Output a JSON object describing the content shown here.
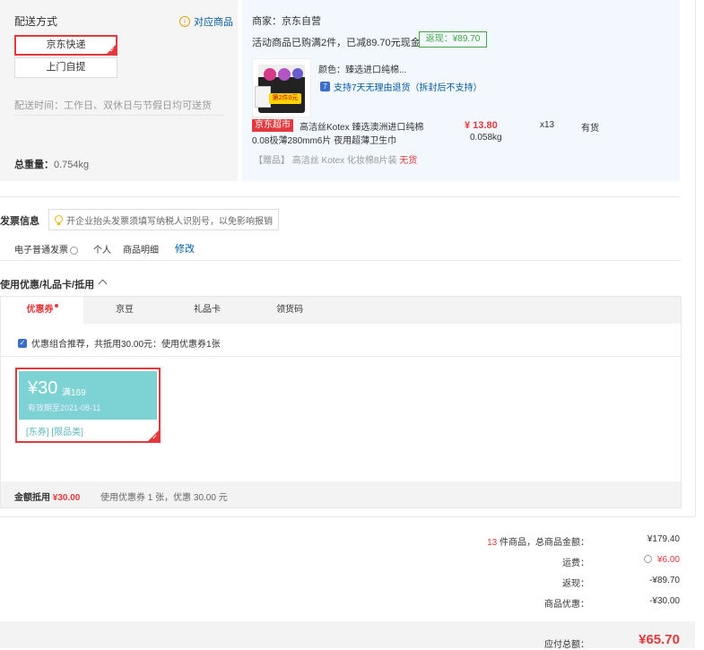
{
  "delivery": {
    "title": "配送方式",
    "matched_goods": "对应商品",
    "options": [
      "京东快递",
      "上门自提"
    ],
    "time": "配送时间：工作日、双休日与节假日均可送货",
    "weight_label": "总重量：",
    "weight_value": "0.754kg"
  },
  "vendor": {
    "name": "商家：京东自营",
    "promo": "活动商品已购满2件，已减89.70元现金",
    "rebate_tag": "返现：¥89.70",
    "product": {
      "color": "颜色：臻选进口纯棉...",
      "return_policy": "支持7天无理由退货（拆封后不支持）",
      "store_tag": "京东超市",
      "title_line1": "高洁丝Kotex 臻选澳洲进口纯棉",
      "title_line2": "0.08极薄280mm6片 夜用超薄卫生巾",
      "price": "¥ 13.80",
      "weight": "0.058kg",
      "qty": "x13",
      "stock": "有货",
      "image_promo": "第2件0元"
    },
    "gift": {
      "prefix": "【赠品】",
      "name": "高洁丝 Kotex 化妆棉8片装",
      "status": "无货"
    }
  },
  "invoice": {
    "title": "发票信息",
    "tip": "开企业抬头发票须填写纳税人识别号，以免影响报销",
    "type": "电子普通发票",
    "person": "个人",
    "detail": "商品明细",
    "edit": "修改"
  },
  "coupons": {
    "title": "使用优惠/礼品卡/抵用",
    "tabs": [
      "优惠券",
      "京豆",
      "礼品卡",
      "领货码"
    ],
    "combo": "优惠组合推荐，共抵用30.00元：使用优惠券1张",
    "coupon": {
      "amount": "¥30",
      "condition": "满169",
      "expiry": "有效期至2021-08-11",
      "tags": "[东券] [限品类]"
    },
    "amount_label": "金额抵用",
    "amount_value": "¥30.00",
    "amount_desc": "使用优惠券 1 张，优惠 30.00 元"
  },
  "summary": {
    "count": "13",
    "count_suffix": "件商品，总商品金额：",
    "total": "¥179.40",
    "shipping_label": "运费：",
    "shipping": "¥6.00",
    "rebate_label": "返现：",
    "rebate": "-¥89.70",
    "discount_label": "商品优惠：",
    "discount": "-¥30.00",
    "pay_label": "应付总额：",
    "pay": "¥65.70"
  }
}
